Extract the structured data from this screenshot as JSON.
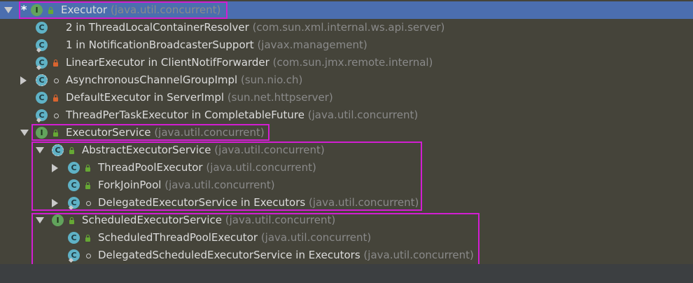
{
  "tree": {
    "rows": [
      {
        "name": "Executor",
        "pkg": "(java.util.concurrent)"
      },
      {
        "name": "2 in ThreadLocalContainerResolver",
        "pkg": "(com.sun.xml.internal.ws.api.server)"
      },
      {
        "name": "1 in NotificationBroadcasterSupport",
        "pkg": "(javax.management)"
      },
      {
        "name": "LinearExecutor in ClientNotifForwarder",
        "pkg": "(com.sun.jmx.remote.internal)"
      },
      {
        "name": "AsynchronousChannelGroupImpl",
        "pkg": "(sun.nio.ch)"
      },
      {
        "name": "DefaultExecutor in ServerImpl",
        "pkg": "(sun.net.httpserver)"
      },
      {
        "name": "ThreadPerTaskExecutor in CompletableFuture",
        "pkg": "(java.util.concurrent)"
      },
      {
        "name": "ExecutorService",
        "pkg": "(java.util.concurrent)"
      },
      {
        "name": "AbstractExecutorService",
        "pkg": "(java.util.concurrent)"
      },
      {
        "name": "ThreadPoolExecutor",
        "pkg": "(java.util.concurrent)"
      },
      {
        "name": "ForkJoinPool",
        "pkg": "(java.util.concurrent)"
      },
      {
        "name": "DelegatedExecutorService in Executors",
        "pkg": "(java.util.concurrent)"
      },
      {
        "name": "ScheduledExecutorService",
        "pkg": "(java.util.concurrent)"
      },
      {
        "name": "ScheduledThreadPoolExecutor",
        "pkg": "(java.util.concurrent)"
      },
      {
        "name": "DelegatedScheduledExecutorService in Executors",
        "pkg": "(java.util.concurrent)"
      }
    ],
    "star": "*",
    "icon_letters": {
      "class": "C",
      "interface": "I"
    }
  },
  "colors": {
    "background": "#45443a",
    "selection": "#4b6eaf",
    "highlight_box": "#d21ed2",
    "class_icon": "#5fb2c6",
    "interface_icon": "#62a35c"
  }
}
